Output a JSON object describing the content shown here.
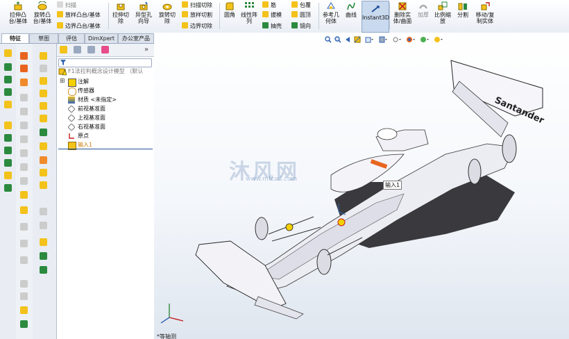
{
  "ribbon": {
    "buttons": [
      {
        "label": "拉伸凸\n台/基体",
        "icon": "extrude-boss-icon"
      },
      {
        "label": "旋转凸\n台/基体",
        "icon": "revolve-boss-icon"
      },
      {
        "label": "拉伸切\n除",
        "icon": "extruded-cut-icon"
      },
      {
        "label": "异型孔\n向导",
        "icon": "hole-wizard-icon"
      },
      {
        "label": "旋转切\n除",
        "icon": "revolved-cut-icon"
      },
      {
        "label": "圆角",
        "icon": "fillet-icon"
      },
      {
        "label": "线性阵\n列",
        "icon": "linear-pattern-icon"
      },
      {
        "label": "参考几\n何体",
        "icon": "reference-geometry-icon"
      },
      {
        "label": "曲线",
        "icon": "curves-icon"
      },
      {
        "label": "Instant3D",
        "icon": "instant3d-icon"
      },
      {
        "label": "删除实\n体/曲面",
        "icon": "delete-body-icon"
      },
      {
        "label": "加厚",
        "icon": "thicken-icon"
      },
      {
        "label": "比例缩\n放",
        "icon": "scale-icon"
      },
      {
        "label": "分割",
        "icon": "split-icon"
      },
      {
        "label": "移动/复\n制实体",
        "icon": "move-copy-body-icon"
      }
    ],
    "small": {
      "sweep": "扫描",
      "loft": "放样凸台/基体",
      "boundary": "边界凸台/基体",
      "swept_cut": "扫描切除",
      "lofted_cut": "放样切割",
      "boundary_cut": "边界切除",
      "rib": "筋",
      "draft": "拔模",
      "shell": "抽壳",
      "wrap": "包覆",
      "dome": "圆顶",
      "mirror": "镜向"
    }
  },
  "tabs": [
    "特征",
    "草图",
    "评估",
    "DimXpert",
    "办公室产品"
  ],
  "tree": {
    "root": "F1法拉利概念设计模型 （默认",
    "items": [
      "注解",
      "传感器",
      "材质 <未指定>",
      "前视基准面",
      "上视基准面",
      "右视基准面",
      "原点",
      "输入1"
    ]
  },
  "viewport": {
    "watermark_main": "沐风网",
    "watermark_url": "www.mfcad.com",
    "callout": "输入1",
    "sponsor": "Santander",
    "view_label": "*等轴测"
  },
  "colors": {
    "accent": "#c9d9ee",
    "body": "#ececf3",
    "floor": "#3a3a3e",
    "highlight": "#e8641e"
  }
}
